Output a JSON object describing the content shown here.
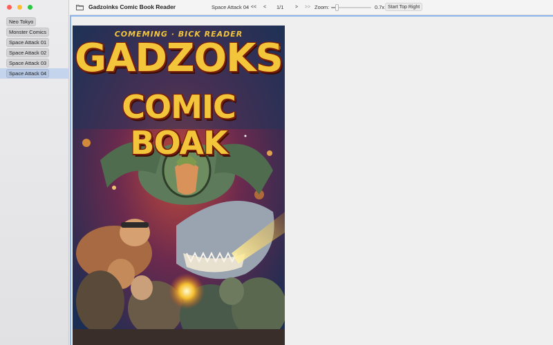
{
  "window": {
    "title": "Gadzoinks Comic Book Reader"
  },
  "sidebar": {
    "items": [
      {
        "label": "Neo Tokyo",
        "selected": false
      },
      {
        "label": "Monster Comics",
        "selected": false
      },
      {
        "label": "Space Attack 01",
        "selected": false
      },
      {
        "label": "Space Attack 02",
        "selected": false
      },
      {
        "label": "Space Attack 03",
        "selected": false
      },
      {
        "label": "Space Attack 04",
        "selected": true
      }
    ]
  },
  "toolbar": {
    "current_series": "Space Attack 04",
    "first_label": "<<",
    "prev_label": "<",
    "page_indicator": "1/1",
    "next_label": ">",
    "last_label": ">>",
    "zoom_label": "Zoom:",
    "zoom_value": "0.7x",
    "zoom_fraction": 0.12,
    "start_label": "Start Top Right",
    "folder_icon": "folder-icon"
  },
  "cover": {
    "top_line": "COMEMING · BICK READER",
    "title_line1": "GADZOKS",
    "title_line2": "COMIC BOAK",
    "registered": "®"
  },
  "colors": {
    "accent": "#8ab4ee",
    "selected_row": "#c4d4ec",
    "cover_yellow": "#f2c53b",
    "cover_outline": "#7a1f0b"
  }
}
